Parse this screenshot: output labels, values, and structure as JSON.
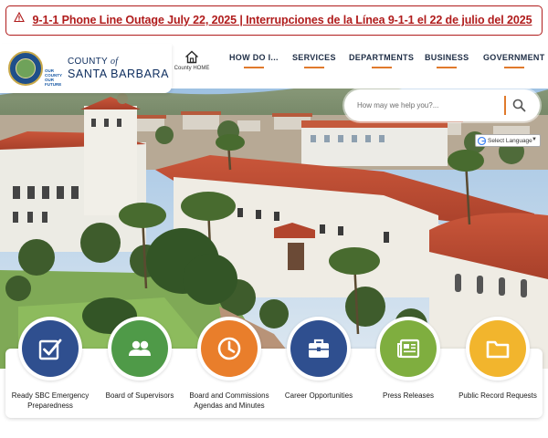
{
  "alert": {
    "text": "9-1-1 Phone Line Outage July 22, 2025 | Interrupciones de la Línea 9-1-1 el 22 de julio del 2025",
    "color": "#b01c1c"
  },
  "header": {
    "logo": {
      "county_prefix": "COUNTY",
      "county_of": "of",
      "name": "SANTA BARBARA",
      "mini_logo": [
        "OUR",
        "COUNTY",
        "OUR",
        "FUTURE"
      ]
    },
    "home_label": "County HOME",
    "nav": [
      "HOW DO I...",
      "SERVICES",
      "DEPARTMENTS",
      "BUSINESS",
      "GOVERNMENT"
    ]
  },
  "search": {
    "placeholder": "How may we help you?..."
  },
  "language": {
    "label": "Select Language"
  },
  "quick_links": [
    {
      "label": "Ready SBC Emergency Preparedness",
      "icon": "check-square-icon",
      "color": "#2f4f8f"
    },
    {
      "label": "Board of Supervisors",
      "icon": "users-icon",
      "color": "#4f9a48"
    },
    {
      "label": "Board and Commissions Agendas and Minutes",
      "icon": "clock-icon",
      "color": "#e97e2b"
    },
    {
      "label": "Career Opportunities",
      "icon": "briefcase-icon",
      "color": "#2f4f8f"
    },
    {
      "label": "Press Releases",
      "icon": "newspaper-icon",
      "color": "#7fae3f"
    },
    {
      "label": "Public Record Requests",
      "icon": "folder-icon",
      "color": "#f2b52d"
    }
  ],
  "colors": {
    "navy": "#0d2d5e",
    "accent_orange": "#e07a2c"
  }
}
